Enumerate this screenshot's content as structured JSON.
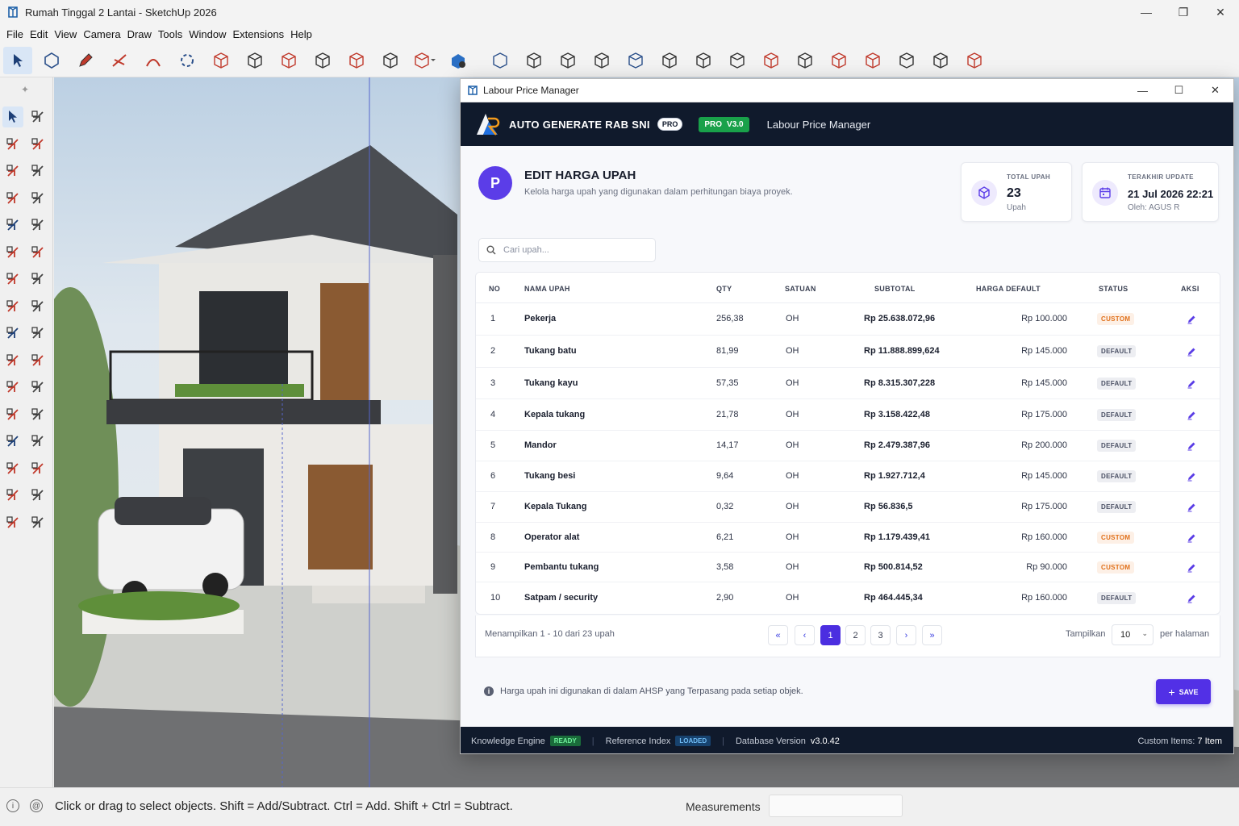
{
  "app": {
    "title": "Rumah Tinggal 2 Lantai - SketchUp 2026",
    "menu": [
      "File",
      "Edit",
      "View",
      "Camera",
      "Draw",
      "Tools",
      "Window",
      "Extensions",
      "Help"
    ],
    "status_hint": "Click or drag to select objects. Shift = Add/Subtract. Ctrl = Add. Shift + Ctrl = Subtract.",
    "measurements_label": "Measurements",
    "measurements_value": ""
  },
  "plugin": {
    "window_title": "Labour Price Manager",
    "brand": "AUTO GENERATE RAB SNI",
    "brand_badge": "PRO",
    "pro_label": "PRO",
    "version": "V3.0",
    "module": "Labour Price Manager",
    "avatar_letter": "P",
    "heading": "EDIT HARGA UPAH",
    "subheading": "Kelola harga upah yang digunakan dalam perhitungan biaya proyek.",
    "total_card": {
      "label": "TOTAL UPAH",
      "value": "23",
      "sub": "Upah"
    },
    "update_card": {
      "label": "TERAKHIR UPDATE",
      "value": "21 Jul 2026 22:21",
      "sub": "Oleh: AGUS R"
    },
    "search_placeholder": "Cari upah...",
    "columns": [
      "NO",
      "NAMA UPAH",
      "QTY",
      "SATUAN",
      "SUBTOTAL",
      "HARGA DEFAULT",
      "STATUS",
      "AKSI"
    ],
    "rows": [
      {
        "no": "1",
        "nama": "Pekerja",
        "qty": "256,38",
        "satuan": "OH",
        "subtotal": "Rp 25.638.072,96",
        "harga": "Rp 100.000",
        "status": "CUSTOM"
      },
      {
        "no": "2",
        "nama": "Tukang batu",
        "qty": "81,99",
        "satuan": "OH",
        "subtotal": "Rp 11.888.899,624",
        "harga": "Rp 145.000",
        "status": "DEFAULT"
      },
      {
        "no": "3",
        "nama": "Tukang kayu",
        "qty": "57,35",
        "satuan": "OH",
        "subtotal": "Rp 8.315.307,228",
        "harga": "Rp 145.000",
        "status": "DEFAULT"
      },
      {
        "no": "4",
        "nama": "Kepala tukang",
        "qty": "21,78",
        "satuan": "OH",
        "subtotal": "Rp 3.158.422,48",
        "harga": "Rp 175.000",
        "status": "DEFAULT"
      },
      {
        "no": "5",
        "nama": "Mandor",
        "qty": "14,17",
        "satuan": "OH",
        "subtotal": "Rp 2.479.387,96",
        "harga": "Rp 200.000",
        "status": "DEFAULT"
      },
      {
        "no": "6",
        "nama": "Tukang besi",
        "qty": "9,64",
        "satuan": "OH",
        "subtotal": "Rp 1.927.712,4",
        "harga": "Rp 145.000",
        "status": "DEFAULT"
      },
      {
        "no": "7",
        "nama": "Kepala Tukang",
        "qty": "0,32",
        "satuan": "OH",
        "subtotal": "Rp 56.836,5",
        "harga": "Rp 175.000",
        "status": "DEFAULT"
      },
      {
        "no": "8",
        "nama": "Operator alat",
        "qty": "6,21",
        "satuan": "OH",
        "subtotal": "Rp 1.179.439,41",
        "harga": "Rp 160.000",
        "status": "CUSTOM"
      },
      {
        "no": "9",
        "nama": "Pembantu tukang",
        "qty": "3,58",
        "satuan": "OH",
        "subtotal": "Rp 500.814,52",
        "harga": "Rp 90.000",
        "status": "CUSTOM"
      },
      {
        "no": "10",
        "nama": "Satpam / security",
        "qty": "2,90",
        "satuan": "OH",
        "subtotal": "Rp 464.445,34",
        "harga": "Rp 160.000",
        "status": "DEFAULT"
      }
    ],
    "pagination": {
      "info": "Menampilkan 1 - 10 dari 23 upah",
      "first": "«",
      "prev": "‹",
      "pages": [
        "1",
        "2",
        "3"
      ],
      "active_page": "1",
      "next": "›",
      "last": "»",
      "show_label": "Tampilkan",
      "page_size": "10",
      "per_page_label": "per halaman"
    },
    "note": "Harga upah ini digunakan di dalam AHSP yang Terpasang pada setiap objek.",
    "save_label": "SAVE",
    "footer": {
      "engine_label": "Knowledge Engine",
      "engine_status": "READY",
      "index_label": "Reference Index",
      "index_status": "LOADED",
      "db_label": "Database Version",
      "db_version": "v3.0.42",
      "custom_label": "Custom Items:",
      "custom_value": "7 Item"
    }
  },
  "colors": {
    "accent": "#5230e6",
    "header_bg": "#101a2c",
    "custom_badge": "#e0701a",
    "pro_green": "#19a14a"
  }
}
